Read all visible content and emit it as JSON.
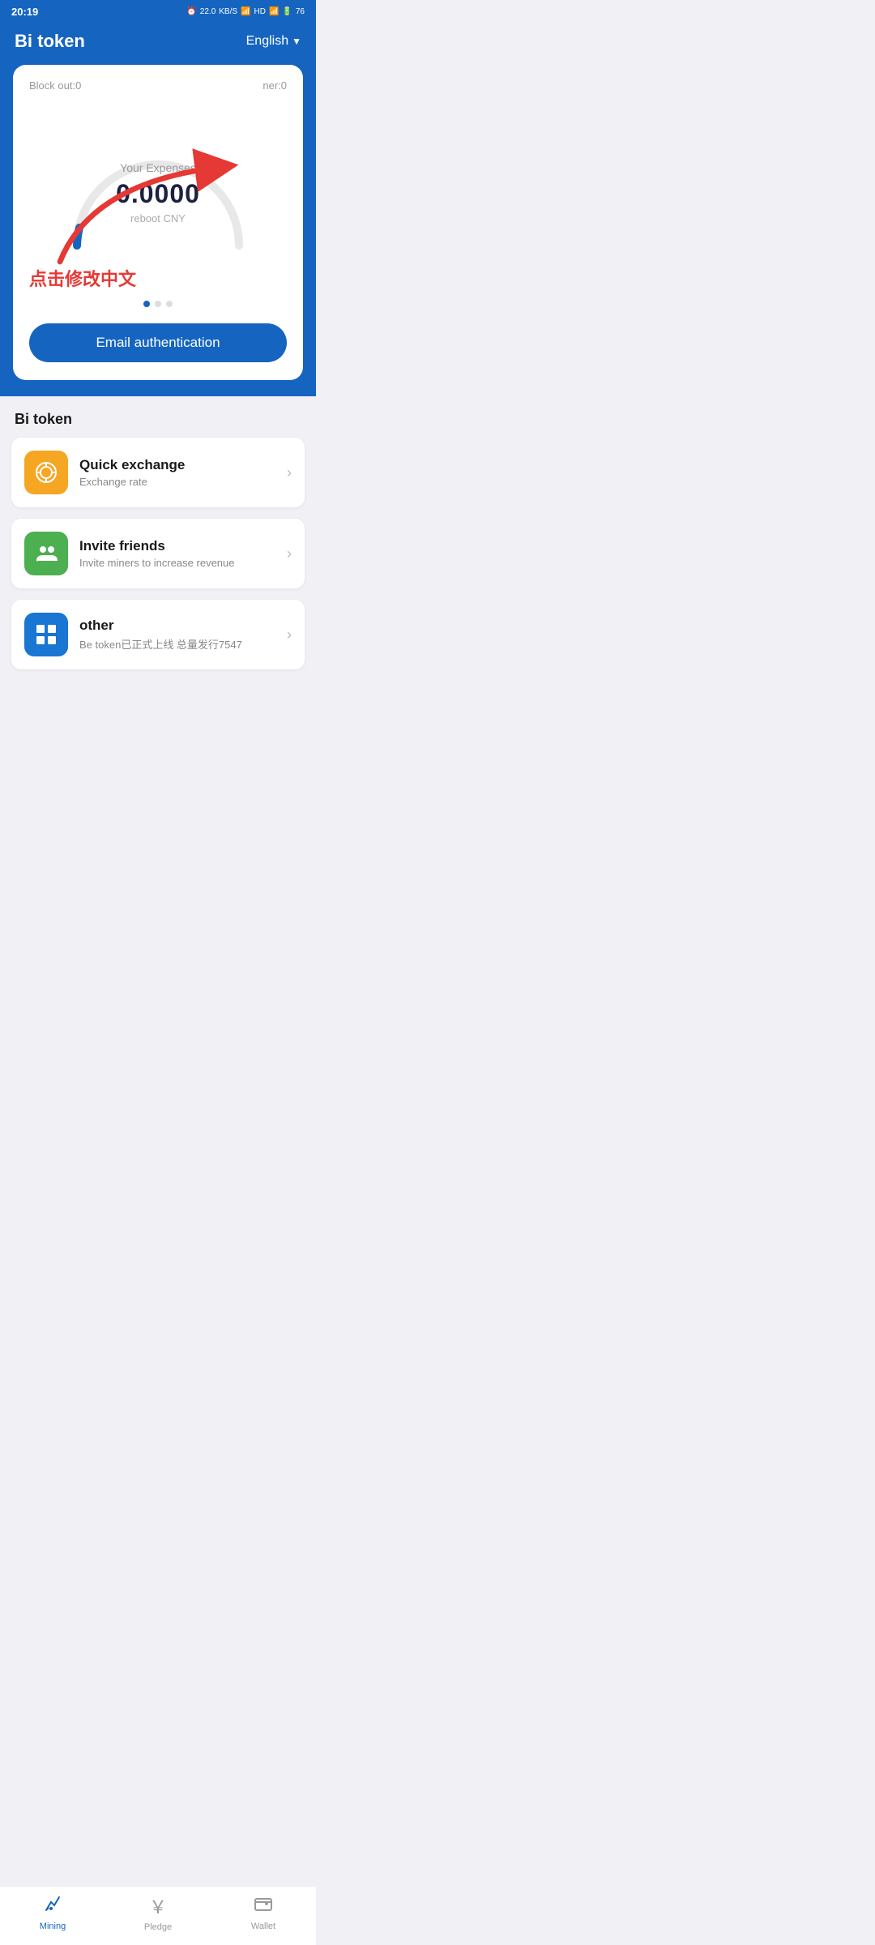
{
  "statusBar": {
    "time": "20:19",
    "speed": "22.0",
    "speedUnit": "KB/S",
    "battery": "76"
  },
  "header": {
    "title": "Bi token",
    "language": "English"
  },
  "card": {
    "blockOut": "Block out:0",
    "minerLabel": "ner:0",
    "gaugeLabel": "Your Expenses",
    "gaugeValue": "0.0000",
    "currencyNote": "reboot CNY",
    "chineseOverlay": "点击修改中文",
    "emailAuthButton": "Email authentication"
  },
  "sectionTitle": "Bi token",
  "listItems": [
    {
      "iconType": "orange",
      "iconSymbol": "🪙",
      "title": "Quick exchange",
      "subtitle": "Exchange rate"
    },
    {
      "iconType": "green",
      "iconSymbol": "👥",
      "title": "Invite friends",
      "subtitle": "Invite miners to increase revenue"
    },
    {
      "iconType": "blue",
      "iconSymbol": "⊞",
      "title": "other",
      "subtitle": "Be token已正式上线 总量发行7547"
    }
  ],
  "bottomNav": [
    {
      "label": "Mining",
      "icon": "⛏",
      "active": true
    },
    {
      "label": "Pledge",
      "icon": "¥",
      "active": false
    },
    {
      "label": "Wallet",
      "icon": "👛",
      "active": false
    }
  ]
}
